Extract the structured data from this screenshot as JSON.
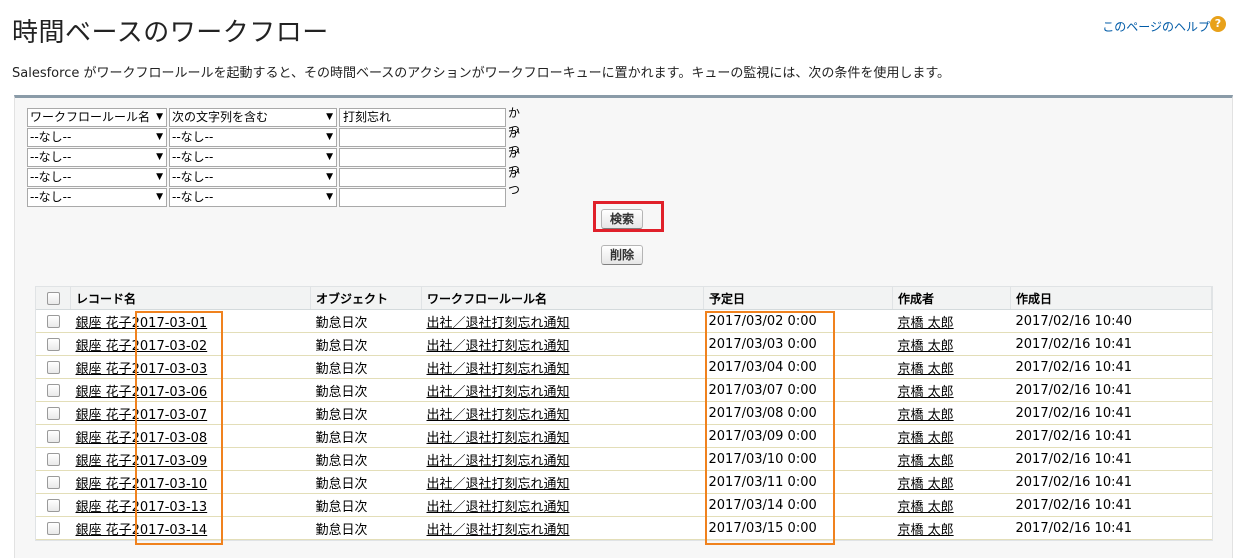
{
  "header": {
    "title": "時間ベースのワークフロー",
    "help_link": "このページのヘルプ",
    "help_icon": "?",
    "description": "Salesforce がワークフロールールを起動すると、その時間ベースのアクションがワークフローキューに置かれます。キューの監視には、次の条件を使用します。"
  },
  "filters": [
    {
      "field": "ワークフロールール名",
      "operator": "次の文字列を含む",
      "value": "打刻忘れ",
      "conj": "かつ"
    },
    {
      "field": "--なし--",
      "operator": "--なし--",
      "value": "",
      "conj": "かつ"
    },
    {
      "field": "--なし--",
      "operator": "--なし--",
      "value": "",
      "conj": "かつ"
    },
    {
      "field": "--なし--",
      "operator": "--なし--",
      "value": "",
      "conj": "かつ"
    },
    {
      "field": "--なし--",
      "operator": "--なし--",
      "value": "",
      "conj": ""
    }
  ],
  "buttons": {
    "search": "検索",
    "delete": "削除"
  },
  "table": {
    "headers": [
      "レコード名",
      "オブジェクト",
      "ワークフロールール名",
      "予定日",
      "作成者",
      "作成日"
    ],
    "rows": [
      [
        "銀座 花子2017-03-01",
        "勤怠日次",
        "出社／退社打刻忘れ通知",
        "2017/03/02 0:00",
        "京橋 太郎",
        "2017/02/16 10:40"
      ],
      [
        "銀座 花子2017-03-02",
        "勤怠日次",
        "出社／退社打刻忘れ通知",
        "2017/03/03 0:00",
        "京橋 太郎",
        "2017/02/16 10:41"
      ],
      [
        "銀座 花子2017-03-03",
        "勤怠日次",
        "出社／退社打刻忘れ通知",
        "2017/03/04 0:00",
        "京橋 太郎",
        "2017/02/16 10:41"
      ],
      [
        "銀座 花子2017-03-06",
        "勤怠日次",
        "出社／退社打刻忘れ通知",
        "2017/03/07 0:00",
        "京橋 太郎",
        "2017/02/16 10:41"
      ],
      [
        "銀座 花子2017-03-07",
        "勤怠日次",
        "出社／退社打刻忘れ通知",
        "2017/03/08 0:00",
        "京橋 太郎",
        "2017/02/16 10:41"
      ],
      [
        "銀座 花子2017-03-08",
        "勤怠日次",
        "出社／退社打刻忘れ通知",
        "2017/03/09 0:00",
        "京橋 太郎",
        "2017/02/16 10:41"
      ],
      [
        "銀座 花子2017-03-09",
        "勤怠日次",
        "出社／退社打刻忘れ通知",
        "2017/03/10 0:00",
        "京橋 太郎",
        "2017/02/16 10:41"
      ],
      [
        "銀座 花子2017-03-10",
        "勤怠日次",
        "出社／退社打刻忘れ通知",
        "2017/03/11 0:00",
        "京橋 太郎",
        "2017/02/16 10:41"
      ],
      [
        "銀座 花子2017-03-13",
        "勤怠日次",
        "出社／退社打刻忘れ通知",
        "2017/03/14 0:00",
        "京橋 太郎",
        "2017/02/16 10:41"
      ],
      [
        "銀座 花子2017-03-14",
        "勤怠日次",
        "出社／退社打刻忘れ通知",
        "2017/03/15 0:00",
        "京橋 太郎",
        "2017/02/16 10:41"
      ]
    ]
  },
  "colors": {
    "highlight_red": "#e0202a",
    "highlight_orange": "#f0821e",
    "link": "#015ba7"
  }
}
